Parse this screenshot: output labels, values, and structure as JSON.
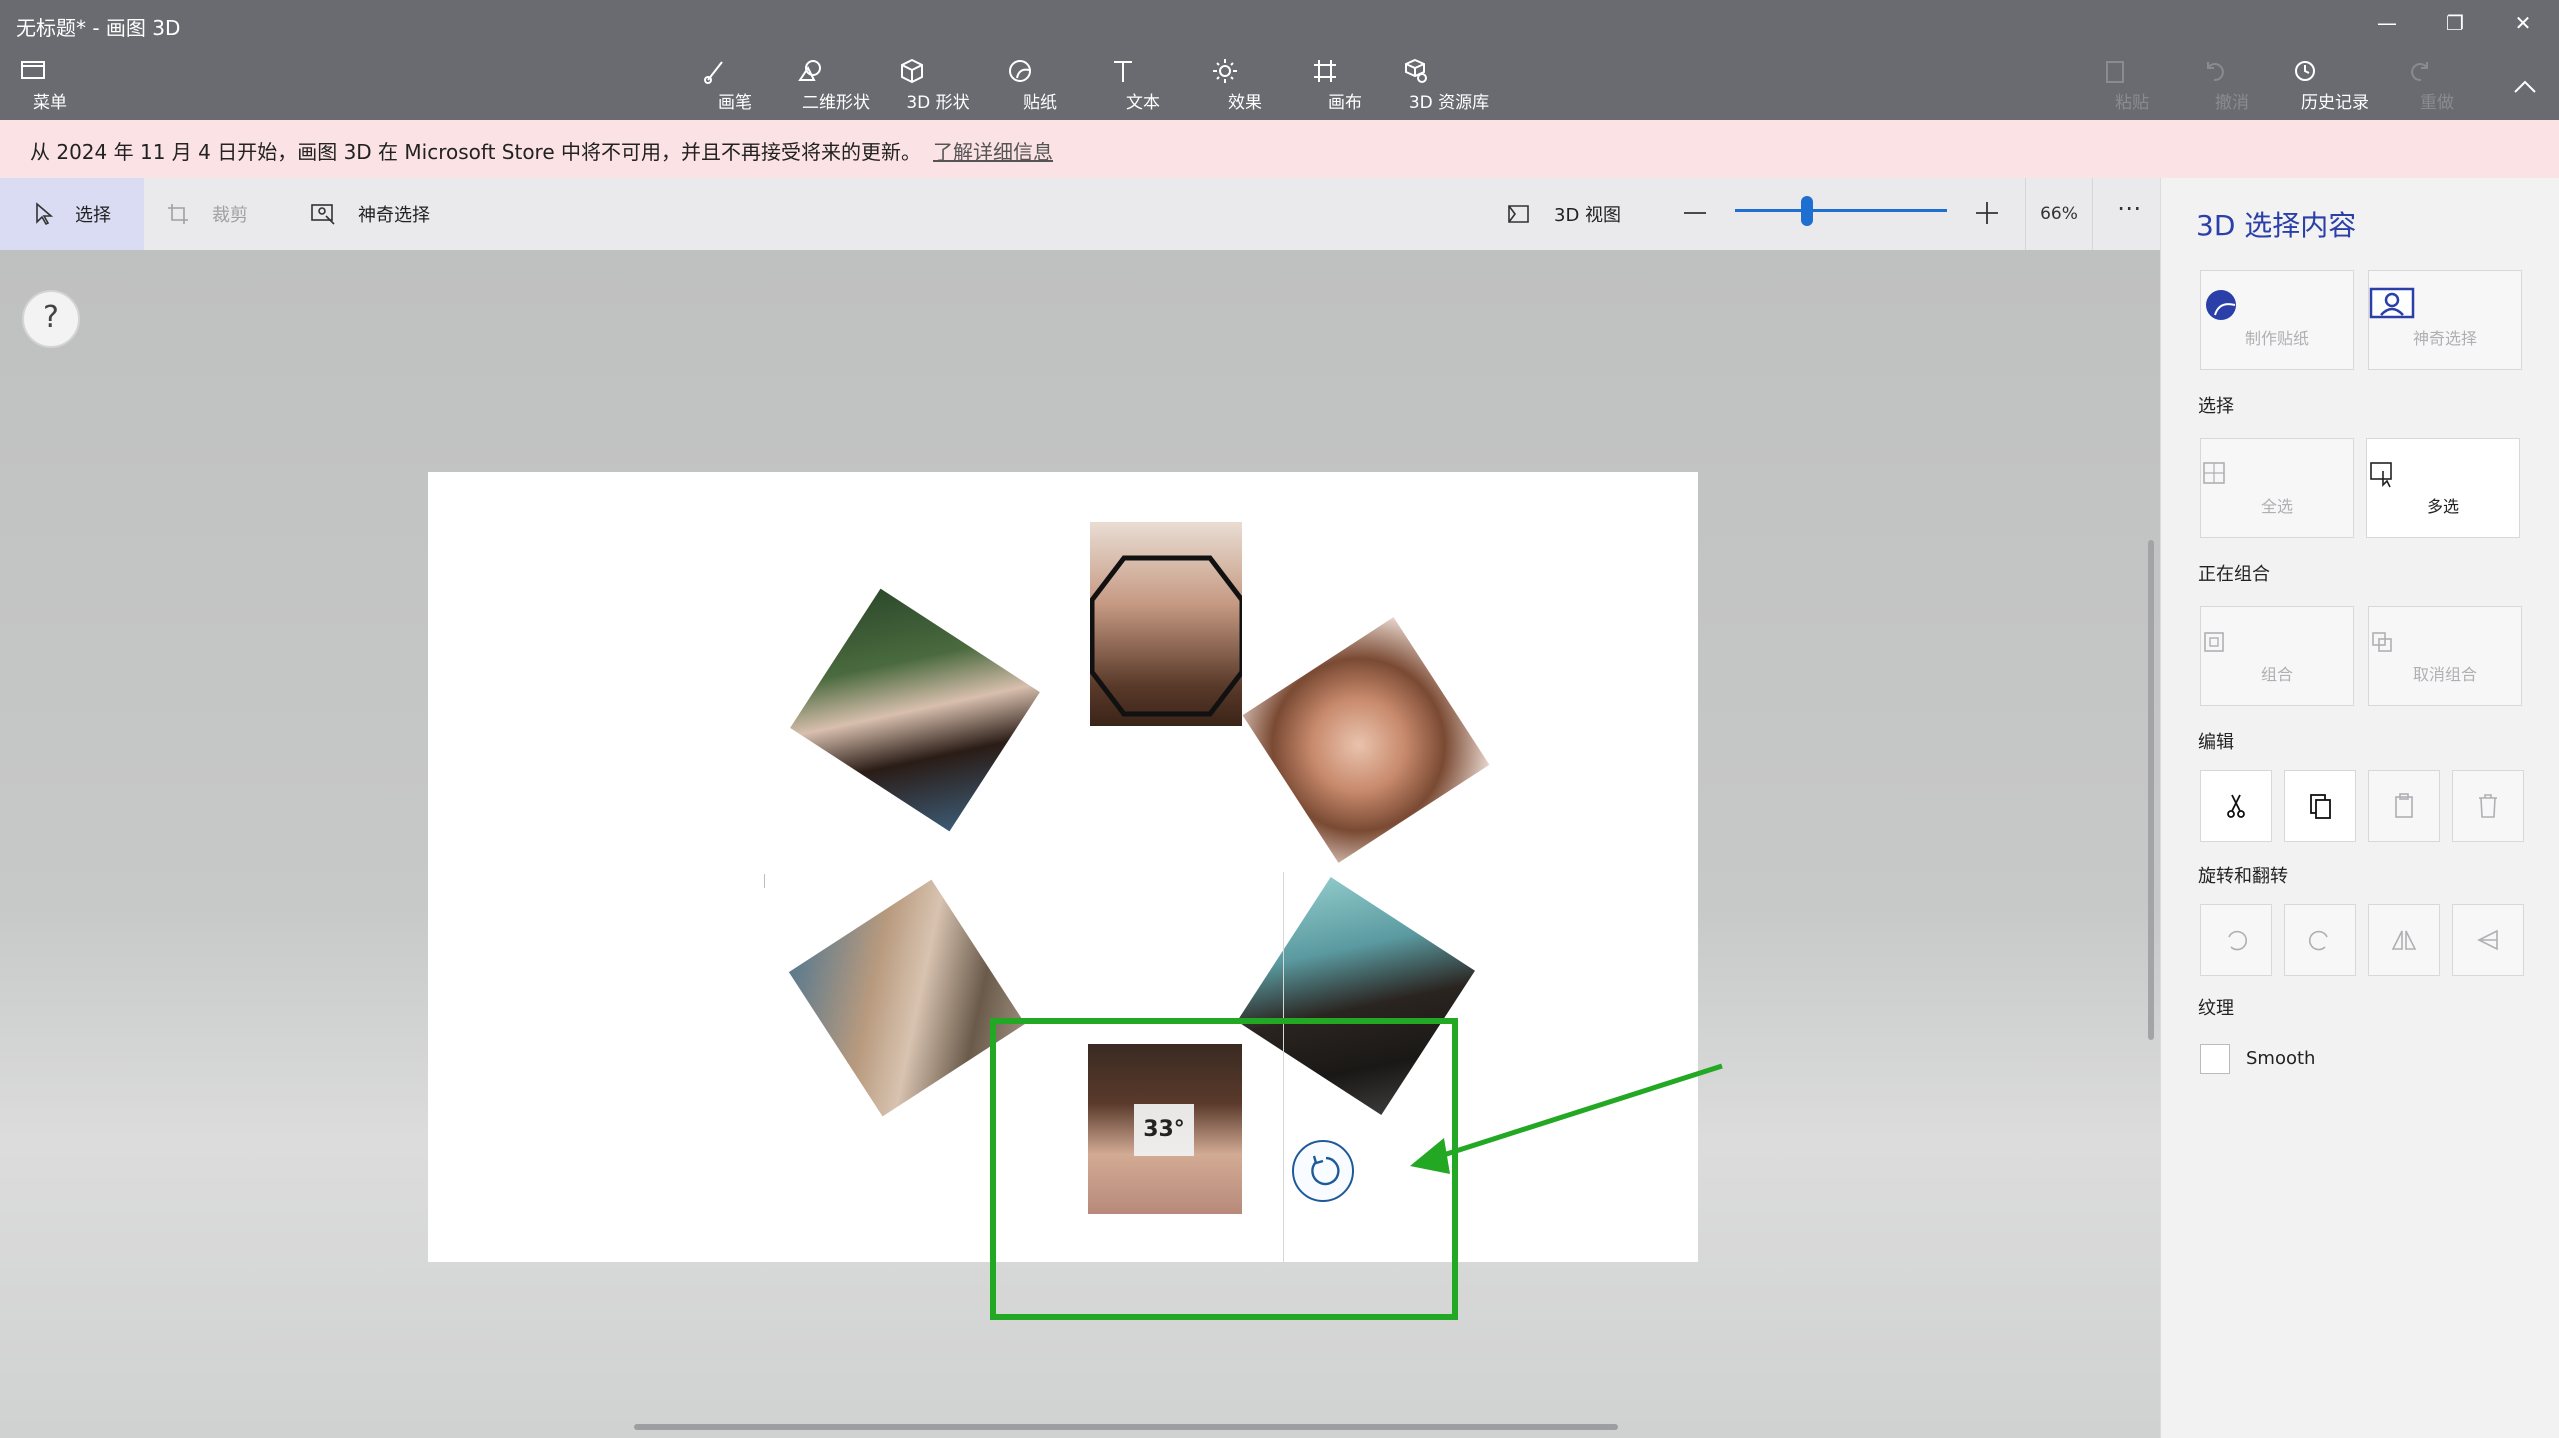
{
  "window": {
    "title": "无标题* - 画图 3D"
  },
  "ribbon": {
    "menu": "菜单",
    "tools": [
      "画笔",
      "二维形状",
      "3D 形状",
      "贴纸",
      "文本",
      "效果",
      "画布",
      "3D 资源库"
    ],
    "actions": [
      "粘贴",
      "撤消",
      "历史记录",
      "重做"
    ]
  },
  "notice": {
    "text": "从 2024 年 11 月 4 日开始，画图 3D 在 Microsoft Store 中将不可用，并且不再接受将来的更新。",
    "link": "了解详细信息"
  },
  "toolbar": {
    "select": "选择",
    "crop": "裁剪",
    "magic_select": "神奇选择",
    "view3d": "3D 视图",
    "zoom_label": "66%",
    "zoom_fraction": 0.33
  },
  "canvas": {
    "rotation_label": "33°"
  },
  "panel": {
    "title": "3D 选择内容",
    "make_sticker": "制作贴纸",
    "magic_select": "神奇选择",
    "section_select": "选择",
    "select_all": "全选",
    "multi_select": "多选",
    "section_group": "正在组合",
    "group": "组合",
    "ungroup": "取消组合",
    "section_edit": "编辑",
    "section_rotate": "旋转和翻转",
    "section_texture": "纹理",
    "smooth": "Smooth"
  },
  "colors": {
    "accent": "#2a3fa8",
    "highlight": "#22a822",
    "ribbon": "#6a6b70"
  }
}
